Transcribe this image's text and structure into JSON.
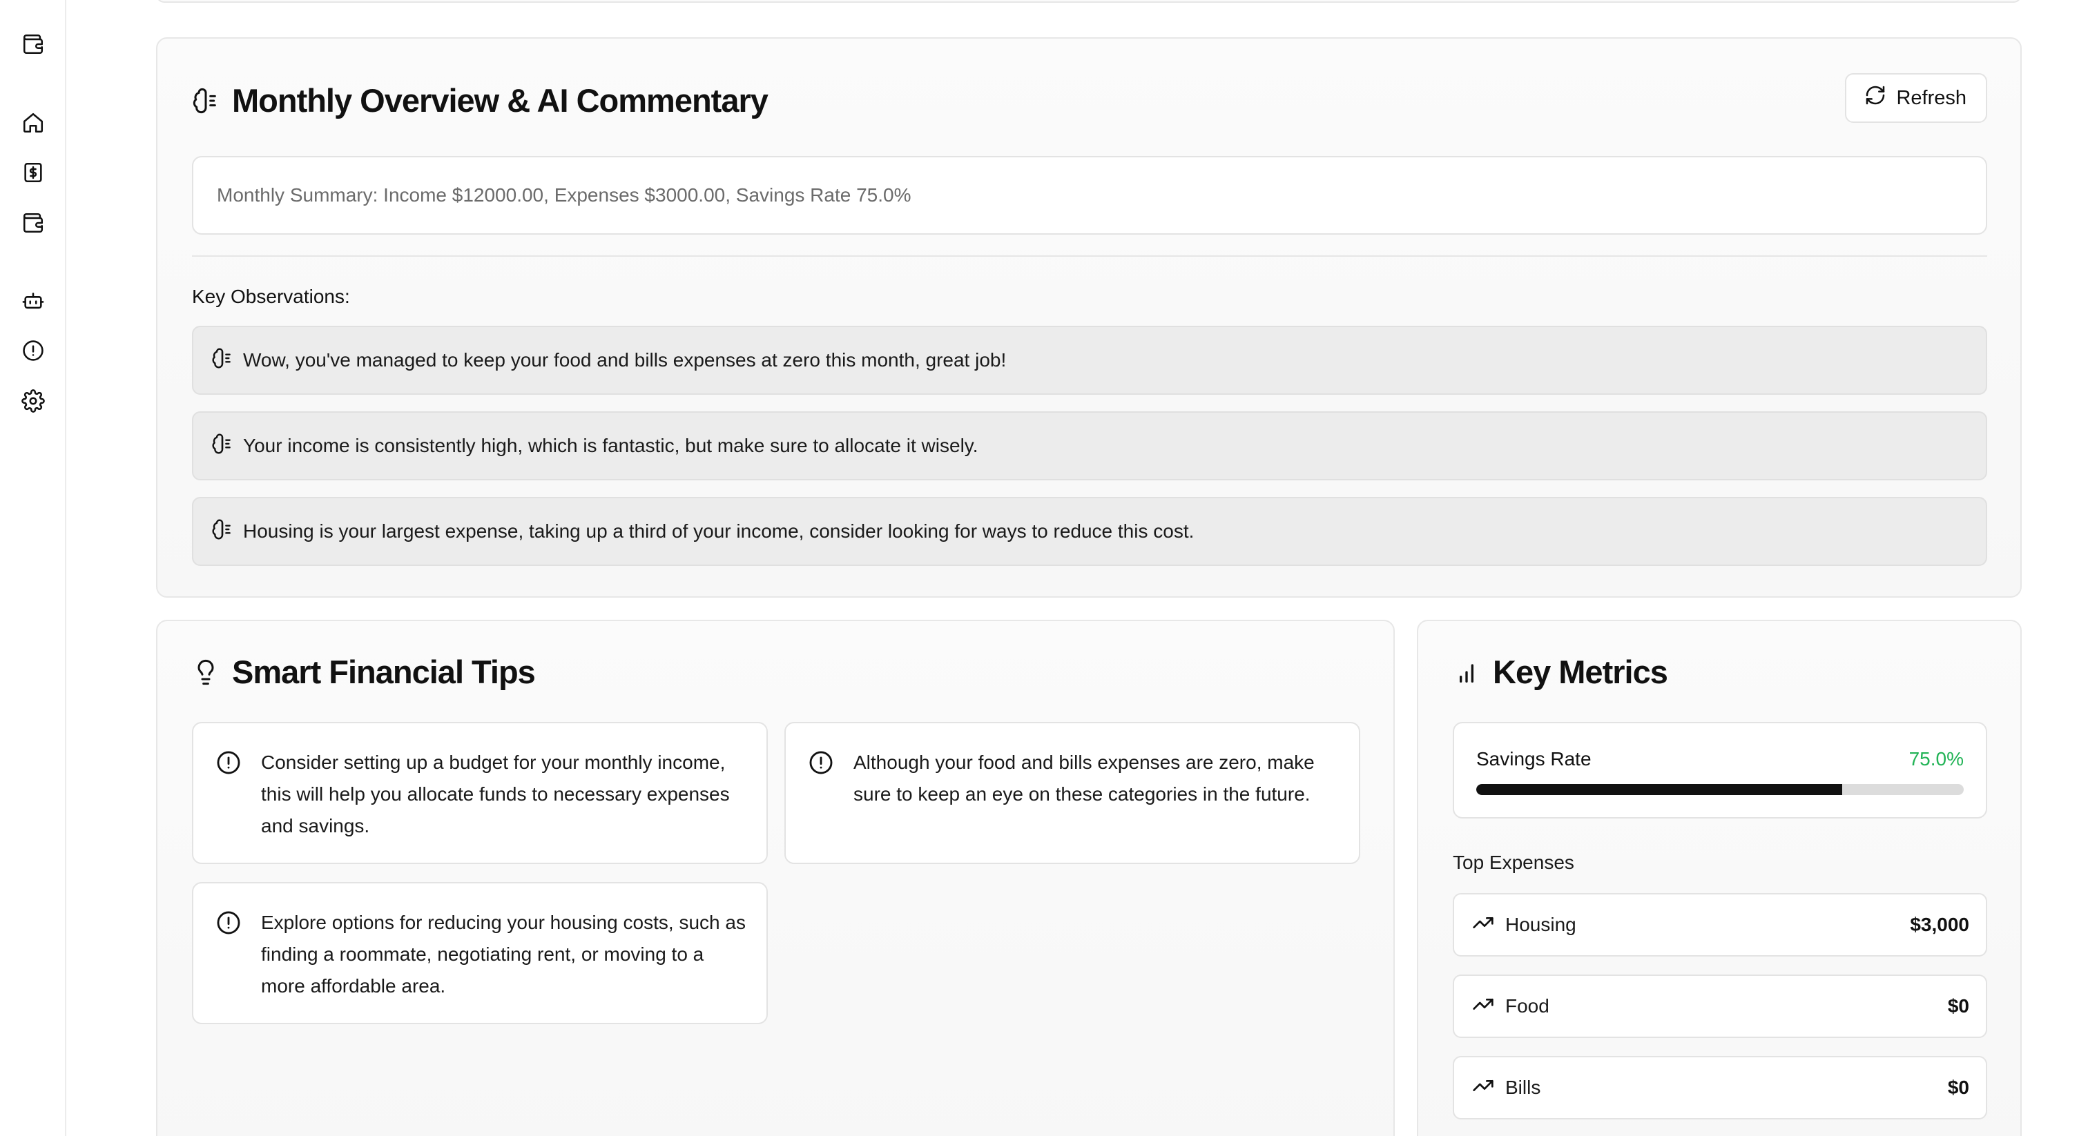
{
  "sidebar": {
    "items": [
      {
        "icon": "wallet-icon",
        "name": "logo"
      },
      {
        "icon": "home-icon",
        "name": "home"
      },
      {
        "icon": "dollar-icon",
        "name": "transactions"
      },
      {
        "icon": "wallet-icon",
        "name": "budget"
      },
      {
        "icon": "bot-icon",
        "name": "assistant"
      },
      {
        "icon": "alert-circle-icon",
        "name": "alerts"
      },
      {
        "icon": "gear-icon",
        "name": "settings"
      }
    ]
  },
  "overview": {
    "title": "Monthly Overview & AI Commentary",
    "refresh_label": "Refresh",
    "summary_placeholder": "Monthly Summary: Income $12000.00, Expenses $3000.00, Savings Rate 75.0%",
    "observations_title": "Key Observations:",
    "observations": [
      "Wow, you've managed to keep your food and bills expenses at zero this month, great job!",
      "Your income is consistently high, which is fantastic, but make sure to allocate it wisely.",
      "Housing is your largest expense, taking up a third of your income, consider looking for ways to reduce this cost."
    ]
  },
  "tips": {
    "title": "Smart Financial Tips",
    "items": [
      "Consider setting up a budget for your monthly income, this will help you allocate funds to necessary expenses and savings.",
      "Although your food and bills expenses are zero, make sure to keep an eye on these categories in the future.",
      "Explore options for reducing your housing costs, such as finding a roommate, negotiating rent, or moving to a more affordable area."
    ]
  },
  "metrics": {
    "title": "Key Metrics",
    "savings_label": "Savings Rate",
    "savings_value": "75.0%",
    "savings_fraction": 0.75,
    "accent_color": "#22b356",
    "top_expenses_title": "Top Expenses",
    "expenses": [
      {
        "name": "Housing",
        "amount": "$3,000"
      },
      {
        "name": "Food",
        "amount": "$0"
      },
      {
        "name": "Bills",
        "amount": "$0"
      }
    ]
  }
}
